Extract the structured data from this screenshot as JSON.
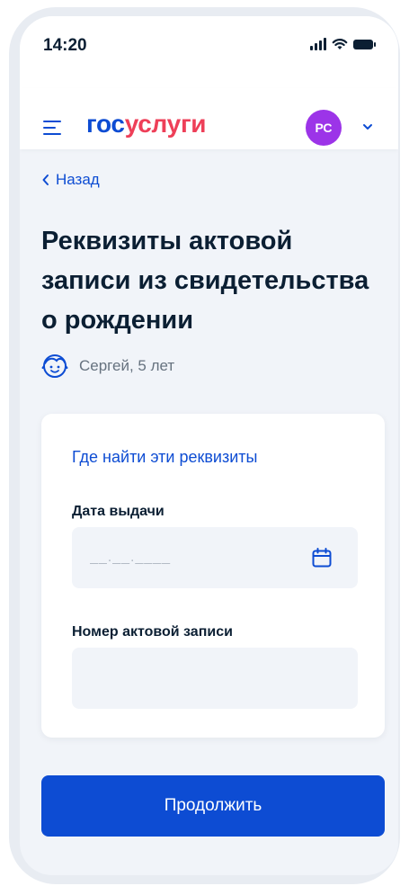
{
  "status_bar": {
    "time": "14:20"
  },
  "header": {
    "logo_part1": "гос",
    "logo_part2": "услуги",
    "avatar_initials": "РС",
    "colors": {
      "brand_blue": "#0d4cd3",
      "brand_red": "#ee3f58",
      "avatar_bg": "#9c34e8"
    }
  },
  "nav": {
    "back_label": "Назад"
  },
  "page": {
    "title": "Реквизиты актовой записи из свидетельства о рождении",
    "child_name": "Сергей, 5 лет",
    "child_icon": "child-face-icon"
  },
  "form": {
    "help_link": "Где найти эти реквизиты",
    "issue_date": {
      "label": "Дата выдачи",
      "placeholder": "__.__.____",
      "value": "",
      "icon": "calendar-icon"
    },
    "record_number": {
      "label": "Номер актовой записи",
      "value": ""
    }
  },
  "actions": {
    "continue_label": "Продолжить"
  }
}
